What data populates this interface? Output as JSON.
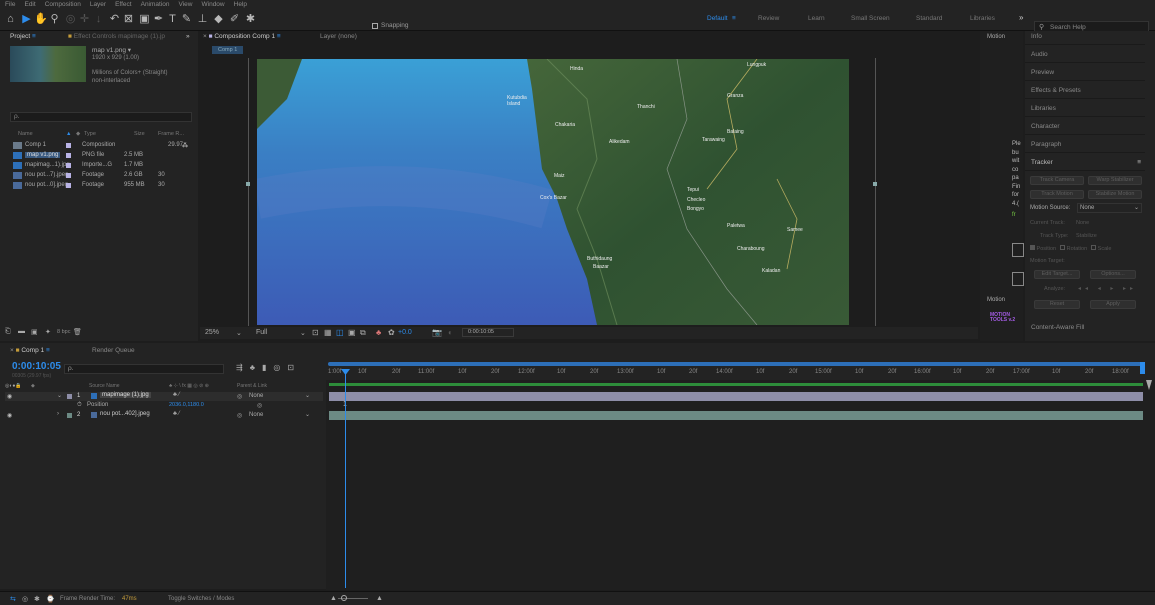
{
  "menu": [
    "File",
    "Edit",
    "Composition",
    "Layer",
    "Effect",
    "Animation",
    "View",
    "Window",
    "Help"
  ],
  "toolbar": {
    "snapping_label": "Snapping",
    "workspaces": [
      {
        "label": "Default",
        "active": true
      },
      {
        "label": "Review",
        "active": false
      },
      {
        "label": "Learn",
        "active": false
      },
      {
        "label": "Small Screen",
        "active": false
      },
      {
        "label": "Standard",
        "active": false
      },
      {
        "label": "Libraries",
        "active": false
      }
    ],
    "search_placeholder": "Search Help",
    "overflow": "»"
  },
  "project": {
    "tab_project": "Project",
    "tab_effect_controls": "Effect Controls mapimage (1).jp",
    "item_name": "map v1.png ▾",
    "item_dims": "1920 x 929 (1.00)",
    "item_color": "Millions of Colors+ (Straight)",
    "item_interlace": "non-interlaced",
    "search_placeholder": "ρ.",
    "columns": {
      "name": "Name",
      "type": "Type",
      "size": "Size",
      "frame_rate": "Frame R..."
    },
    "items": [
      {
        "name": "Comp 1",
        "type": "Composition",
        "size": "",
        "fps": "29.97",
        "color": "#b9b3e6"
      },
      {
        "name": "map v1.png",
        "type": "PNG file",
        "size": "2.5 MB",
        "fps": "",
        "color": "#b9b3e6"
      },
      {
        "name": "mapimag...1).jpg",
        "type": "Importe...G",
        "size": "1.7 MB",
        "fps": "",
        "color": "#b9b3e6"
      },
      {
        "name": "nou pot...7).jpeg",
        "type": "Footage",
        "size": "2.6 GB",
        "fps": "30",
        "color": "#b9b3e6"
      },
      {
        "name": "nou pot...0].jpeg",
        "type": "Footage",
        "size": "955 MB",
        "fps": "30",
        "color": "#b9b3e6"
      }
    ],
    "bpc": "8 bpc"
  },
  "composition": {
    "tab_label": "Composition Comp 1",
    "tab_layer": "Layer (none)",
    "comp_label": "Comp 1",
    "zoom": "25%",
    "resolution": "Full",
    "exposure": "+0.0",
    "timecode": "0:00:10:05"
  },
  "map_labels": [
    "Lungpuk",
    "Hinda",
    "Kutubdia Island",
    "Thanchi",
    "Granza",
    "Chakaria",
    "Alikedam",
    "Balaing",
    "Tarawaing",
    "Cox's Bazar",
    "Maiz",
    "Tepui",
    "Checleo",
    "Bongyo",
    "Paletwa",
    "Samee",
    "Charaboung",
    "Buthidaung",
    "Baazar",
    "Kaladan"
  ],
  "right_panel": {
    "motion_header": "Motion",
    "items": [
      "Info",
      "Audio",
      "Preview",
      "Effects & Presets",
      "Libraries",
      "Character",
      "Paragraph",
      "Tracker"
    ],
    "tracker_buttons": [
      "Track Camera",
      "Warp Stabilizer",
      "Track Motion",
      "Stabilize Motion"
    ],
    "motion_source_label": "Motion Source:",
    "motion_source_value": "None",
    "current_track_label": "Current Track:",
    "current_track_value": "None",
    "track_type_label": "Track Type:",
    "track_type_value": "Stabilize",
    "checkboxes": [
      "Position",
      "Rotation",
      "Scale"
    ],
    "motion_target": "Motion Target:",
    "edit_target": "Edit Target...",
    "options": "Options...",
    "analyze": "Analyze:",
    "reset": "Reset",
    "apply": "Apply",
    "content_aware_fill": "Content-Aware Fill",
    "motion_tools_footer": "Motion",
    "motion_tools_logo": "MOTION TOOLS v.2",
    "side_text": [
      "Ple",
      "bu",
      "wit",
      "co",
      "pa",
      "Fin",
      "for",
      "4.(",
      "fr"
    ]
  },
  "timeline": {
    "tab_comp": "Comp 1",
    "tab_render": "Render Queue",
    "timecode": "0:00:10:05",
    "timecode_sub": "00305 (29.97 fps)",
    "search_placeholder": "ρ.",
    "col_source": "Source Name",
    "col_switches": "♣ ⊹ \\ fx ▦ ◎ ⊘ ⊕",
    "col_parent": "Parent & Link",
    "ruler_ticks": [
      "1:00f",
      "10f",
      "20f",
      "11:00f",
      "10f",
      "20f",
      "12:00f",
      "10f",
      "20f",
      "13:00f",
      "10f",
      "20f",
      "14:00f",
      "10f",
      "20f",
      "15:00f",
      "10f",
      "20f",
      "16:00f",
      "10f",
      "20f",
      "17:00f",
      "10f",
      "20f",
      "18:00f"
    ],
    "layers": [
      {
        "num": "1",
        "name": "mapimage (1).jpg",
        "parent": "None",
        "color": "#8e8ea8"
      },
      {
        "num": "2",
        "name": "nou pot...402].jpeg",
        "parent": "None",
        "color": "#6c8a84"
      }
    ],
    "position_label": "Position",
    "position_value": "2036.0,1180.0",
    "keyframe_marker": "1",
    "footer_render_label": "Frame Render Time:",
    "footer_render_value": "47ms",
    "footer_toggle": "Toggle Switches / Modes"
  }
}
